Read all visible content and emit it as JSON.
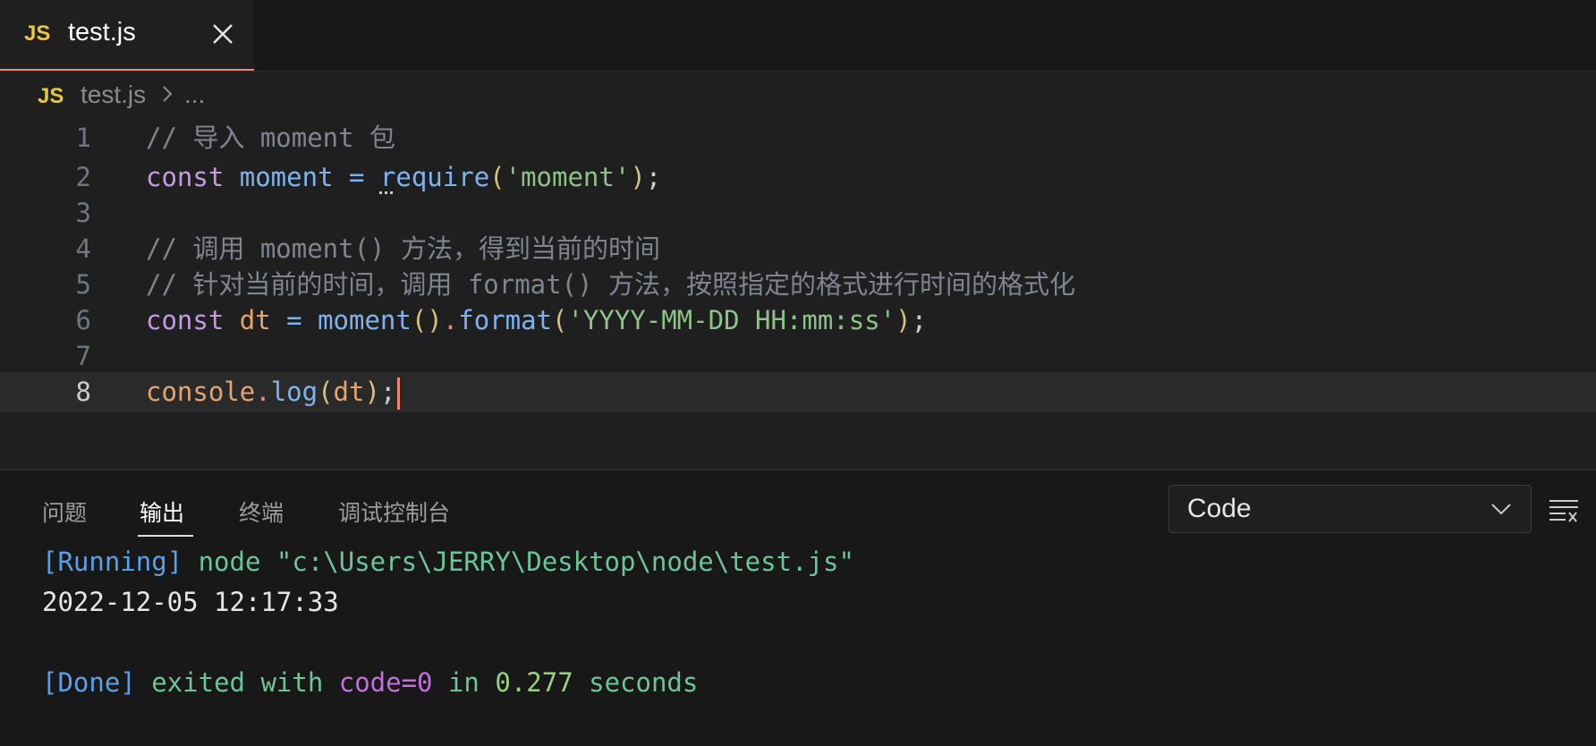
{
  "tab": {
    "badge": "JS",
    "filename": "test.js"
  },
  "breadcrumb": {
    "badge": "JS",
    "file": "test.js",
    "more": "..."
  },
  "editor": {
    "current_line": 8,
    "lines": [
      {
        "number": "1",
        "tokens": [
          {
            "t": "// 导入 moment 包",
            "c": "comment"
          }
        ]
      },
      {
        "number": "2",
        "tokens": [
          {
            "t": "const ",
            "c": "keyword"
          },
          {
            "t": "moment",
            "c": "var"
          },
          {
            "t": " = ",
            "c": "op"
          },
          {
            "t": "r",
            "c": "func squiggle"
          },
          {
            "t": "equire",
            "c": "func"
          },
          {
            "t": "(",
            "c": "paren"
          },
          {
            "t": "'moment'",
            "c": "str"
          },
          {
            "t": ")",
            "c": "paren"
          },
          {
            "t": ";",
            "c": "punc"
          }
        ]
      },
      {
        "number": "3",
        "tokens": []
      },
      {
        "number": "4",
        "tokens": [
          {
            "t": "// 调用 moment() 方法，得到当前的时间",
            "c": "comment"
          }
        ]
      },
      {
        "number": "5",
        "tokens": [
          {
            "t": "// 针对当前的时间，调用 format() 方法，按照指定的格式进行时间的格式化",
            "c": "comment"
          }
        ]
      },
      {
        "number": "6",
        "tokens": [
          {
            "t": "const ",
            "c": "keyword"
          },
          {
            "t": "dt",
            "c": "var2"
          },
          {
            "t": " = ",
            "c": "op"
          },
          {
            "t": "moment",
            "c": "func"
          },
          {
            "t": "()",
            "c": "paren"
          },
          {
            "t": ".",
            "c": "dot"
          },
          {
            "t": "format",
            "c": "func"
          },
          {
            "t": "(",
            "c": "paren"
          },
          {
            "t": "'YYYY-MM-DD HH:mm:ss'",
            "c": "str"
          },
          {
            "t": ")",
            "c": "paren"
          },
          {
            "t": ";",
            "c": "punc"
          }
        ]
      },
      {
        "number": "7",
        "tokens": []
      },
      {
        "number": "8",
        "tokens": [
          {
            "t": "console",
            "c": "var2"
          },
          {
            "t": ".",
            "c": "dot"
          },
          {
            "t": "log",
            "c": "func"
          },
          {
            "t": "(",
            "c": "paren"
          },
          {
            "t": "dt",
            "c": "var2"
          },
          {
            "t": ")",
            "c": "paren"
          },
          {
            "t": ";",
            "c": "punc"
          }
        ]
      }
    ]
  },
  "panel": {
    "tabs": [
      "问题",
      "输出",
      "终端",
      "调试控制台"
    ],
    "active_tab": "输出",
    "output_channel": "Code",
    "output": {
      "running_tag": "[Running]",
      "running_cmd": " node \"c:\\Users\\JERRY\\Desktop\\node\\test.js\"",
      "result": "2022-12-05 12:17:33",
      "done_tag": "[Done]",
      "done_text_1": " exited with ",
      "done_code": "code=0",
      "done_text_2": " in ",
      "done_time": "0.277",
      "done_text_3": " seconds"
    }
  },
  "colors": {
    "accent": "#f4846e",
    "js_badge": "#e7c845",
    "background": "#1f1f1f"
  },
  "icons": {
    "tab_close": "close-icon",
    "breadcrumb_separator": "chevron-right-icon",
    "select_chevron": "chevron-down-icon",
    "clear_output": "clear-output-icon"
  }
}
